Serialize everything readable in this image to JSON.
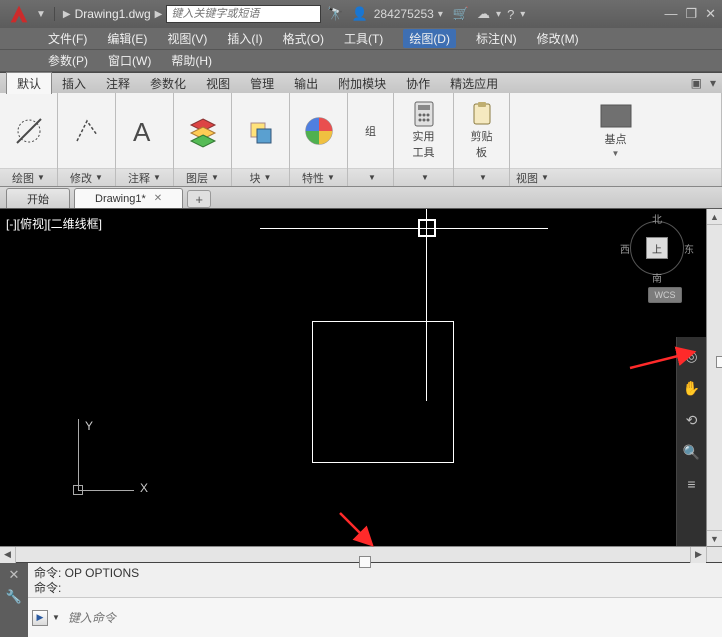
{
  "title": {
    "doc": "Drawing1.dwg",
    "search_placeholder": "键入关键字或短语",
    "user": "284275253"
  },
  "menus": {
    "row1": [
      "文件(F)",
      "编辑(E)",
      "视图(V)",
      "插入(I)",
      "格式(O)",
      "工具(T)",
      "绘图(D)",
      "标注(N)",
      "修改(M)"
    ],
    "row2": [
      "参数(P)",
      "窗口(W)",
      "帮助(H)"
    ],
    "active_index": 6
  },
  "ribbon_tabs": {
    "items": [
      "默认",
      "插入",
      "注释",
      "参数化",
      "视图",
      "管理",
      "输出",
      "附加模块",
      "协作",
      "精选应用"
    ],
    "active_index": 0
  },
  "panels": [
    {
      "title": "绘图"
    },
    {
      "title": "修改"
    },
    {
      "title": "注释"
    },
    {
      "title": "图层"
    },
    {
      "title": "块"
    },
    {
      "title": "特性"
    },
    {
      "title": "组",
      "body": "组"
    },
    {
      "title": "实用工具",
      "body_upper": "实用",
      "body_lower": "工具"
    },
    {
      "title": "剪贴板",
      "body_upper": "剪贴",
      "body_lower": "板"
    }
  ],
  "last_panel": {
    "big": "基点",
    "row": "视图"
  },
  "doctabs": {
    "items": [
      {
        "label": "开始"
      },
      {
        "label": "Drawing1*",
        "close": true
      }
    ],
    "active_index": 1
  },
  "canvas": {
    "label": "[-][俯视][二维线框]",
    "ylbl": "Y",
    "xlbl": "X",
    "compass": {
      "n": "北",
      "s": "南",
      "e": "东",
      "w": "西",
      "top": "上"
    },
    "wcs": "WCS"
  },
  "cmd": {
    "hist": "命令: OP OPTIONS",
    "prompt": "命令:",
    "placeholder": "键入命令"
  }
}
